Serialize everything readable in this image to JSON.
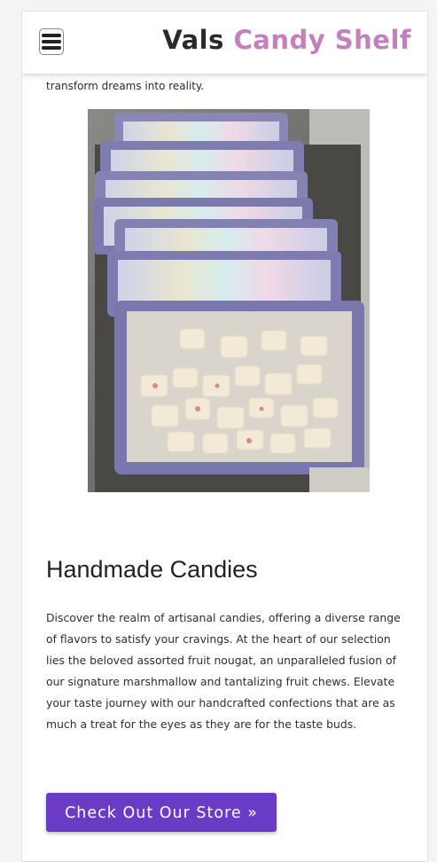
{
  "header": {
    "brand_part1": "Vals",
    "brand_part2": "Candy Shelf",
    "menu_icon": "hamburger-menu-icon"
  },
  "intro": {
    "text": "transform dreams into reality."
  },
  "section": {
    "heading": "Handmade Candies",
    "paragraph": "Discover the realm of artisanal candies, offering a diverse range of flavors to satisfy your cravings. At the heart of our selection lies the beloved assorted fruit nougat, an unparalleled fusion of our signature marshmallow and tantalizing fruit chews. Elevate your taste journey with our handcrafted confections that are as much a treat for the eyes as they are for the taste buds.",
    "cta_label": "Check Out Our Store »"
  },
  "colors": {
    "brand_dark": "#2a2a2a",
    "brand_accent": "#c47fbd",
    "button": "#6a3bc5"
  }
}
